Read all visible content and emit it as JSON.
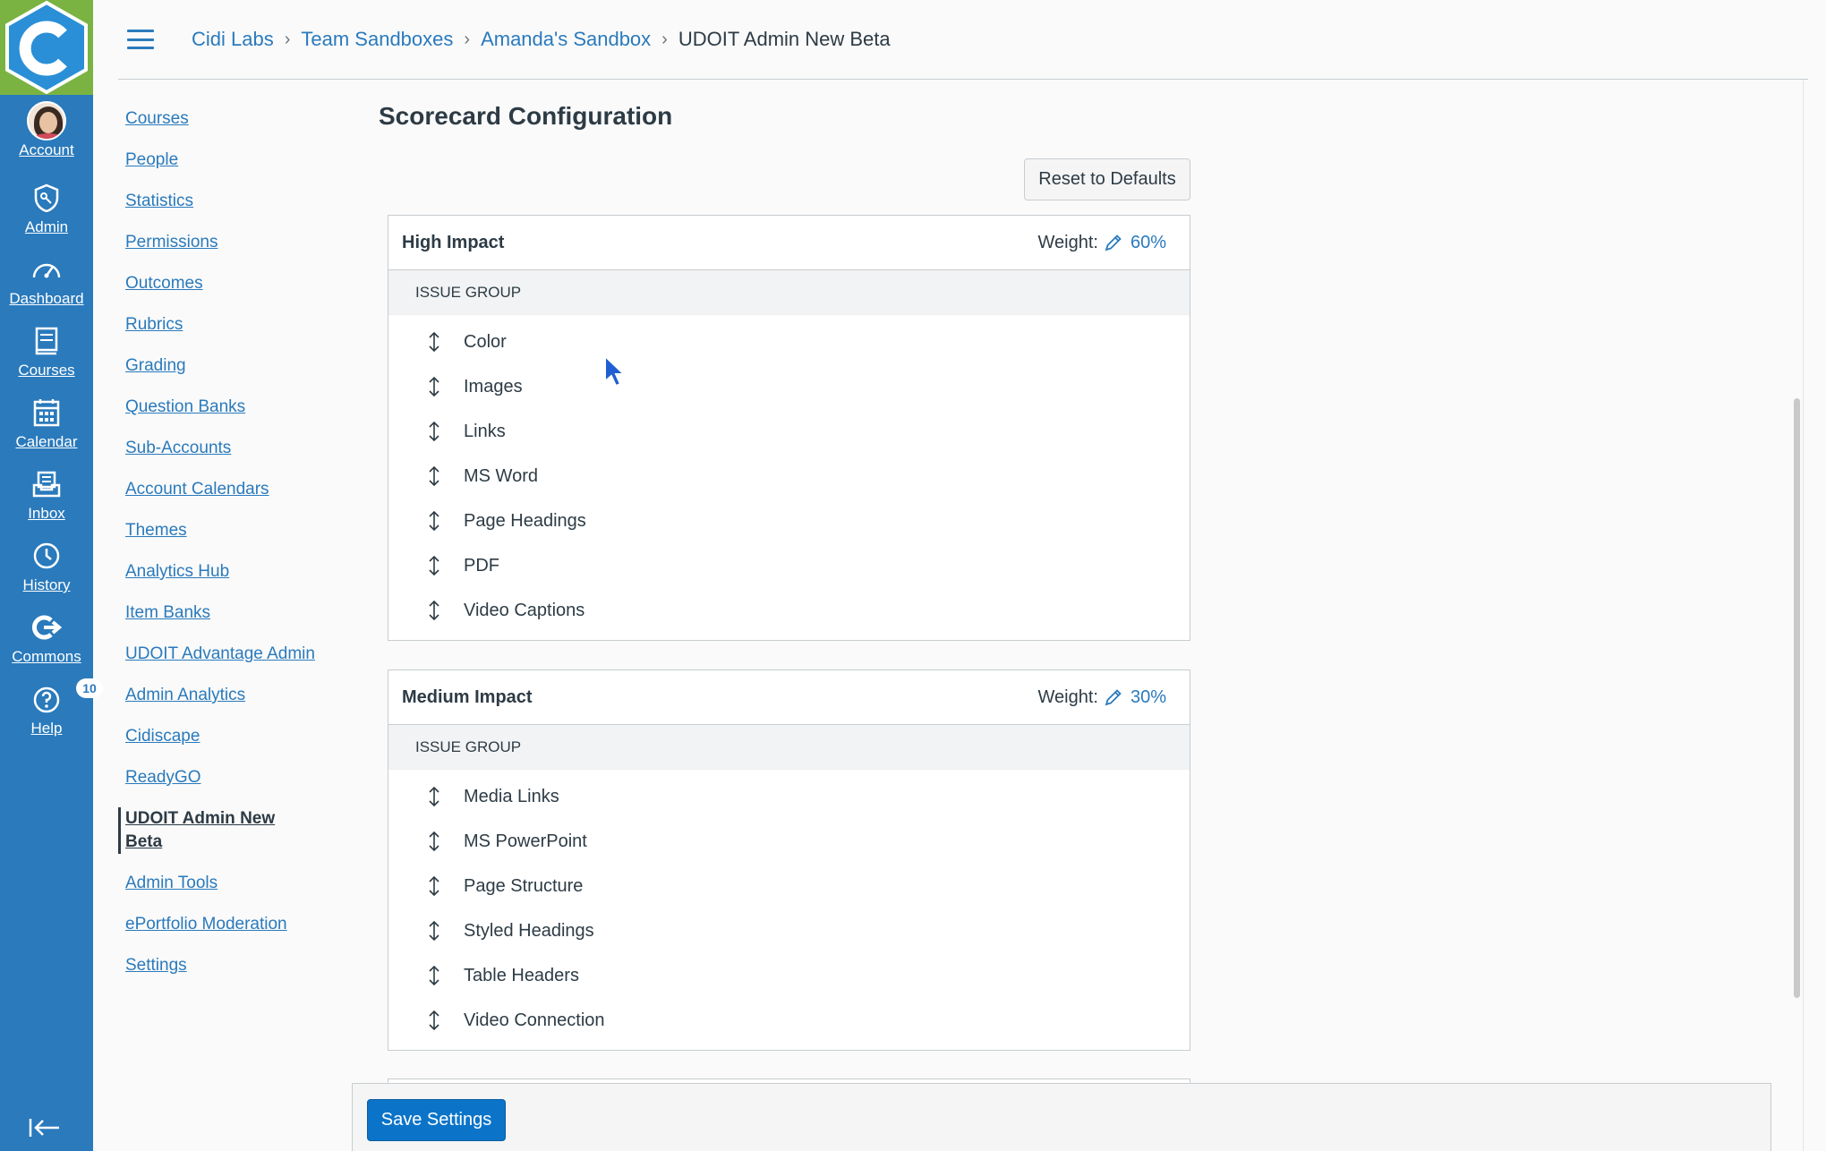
{
  "global_nav": {
    "items": [
      {
        "label": "Account",
        "icon": "avatar"
      },
      {
        "label": "Admin",
        "icon": "shield-icon"
      },
      {
        "label": "Dashboard",
        "icon": "dashboard-icon"
      },
      {
        "label": "Courses",
        "icon": "courses-icon"
      },
      {
        "label": "Calendar",
        "icon": "calendar-icon"
      },
      {
        "label": "Inbox",
        "icon": "inbox-icon"
      },
      {
        "label": "History",
        "icon": "clock-icon"
      },
      {
        "label": "Commons",
        "icon": "commons-icon"
      },
      {
        "label": "Help",
        "icon": "help-icon",
        "badge": "10"
      }
    ],
    "brand_color": "#2a7abc",
    "logo_bg": "#7ab342"
  },
  "breadcrumb": {
    "items": [
      "Cidi Labs",
      "Team Sandboxes",
      "Amanda's Sandbox"
    ],
    "current": "UDOIT Admin New Beta"
  },
  "subnav": {
    "items": [
      "Courses",
      "People",
      "Statistics",
      "Permissions",
      "Outcomes",
      "Rubrics",
      "Grading",
      "Question Banks",
      "Sub-Accounts",
      "Account Calendars",
      "Themes",
      "Analytics Hub",
      "Item Banks",
      "UDOIT Advantage Admin",
      "Admin Analytics",
      "Cidiscape",
      "ReadyGO",
      "UDOIT Admin New Beta",
      "Admin Tools",
      "ePortfolio Moderation",
      "Settings"
    ],
    "active": "UDOIT Admin New Beta"
  },
  "page": {
    "title": "Scorecard Configuration",
    "reset_label": "Reset to Defaults",
    "save_label": "Save Settings"
  },
  "panels": [
    {
      "title": "High Impact",
      "weight_label": "Weight:",
      "weight_value": "60%",
      "group_header": "ISSUE GROUP",
      "groups": [
        "Color",
        "Images",
        "Links",
        "MS Word",
        "Page Headings",
        "PDF",
        "Video Captions"
      ]
    },
    {
      "title": "Medium Impact",
      "weight_label": "Weight:",
      "weight_value": "30%",
      "group_header": "ISSUE GROUP",
      "groups": [
        "Media Links",
        "MS PowerPoint",
        "Page Structure",
        "Styled Headings",
        "Table Headers",
        "Video Connection"
      ]
    }
  ]
}
